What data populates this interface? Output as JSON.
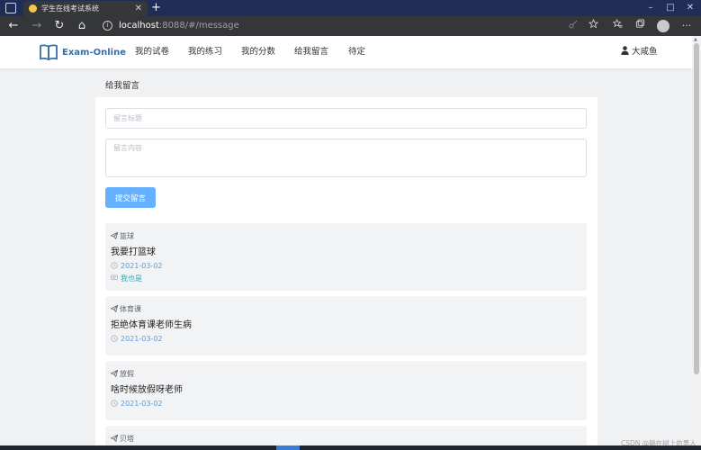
{
  "browser": {
    "tab_title": "学生在线考试系统",
    "url_host": "localhost",
    "url_rest": ":8088/#/message",
    "controls": {
      "back": "←",
      "forward": "→",
      "reload": "↻",
      "home": "⌂",
      "new_tab": "+",
      "minimize": "–",
      "maximize": "□",
      "close": "✕",
      "info": "i",
      "menu": "···"
    }
  },
  "header": {
    "logo_text": "Exam-Online",
    "nav": [
      "我的试卷",
      "我的练习",
      "我的分数",
      "给我留言",
      "待定"
    ],
    "user_name": "大咸鱼"
  },
  "message": {
    "section_title": "给我留言",
    "title_placeholder": "留言标题",
    "body_placeholder": "留言内容",
    "submit_label": "提交留言"
  },
  "cards": [
    {
      "tag": "篮球",
      "title": "我要打篮球",
      "date": "2021-03-02",
      "reply": "我也是"
    },
    {
      "tag": "体育课",
      "title": "拒绝体育课老师生病",
      "date": "2021-03-02"
    },
    {
      "tag": "放假",
      "title": "啥时候放假呀老师",
      "date": "2021-03-02"
    },
    {
      "tag": "贝塔"
    }
  ],
  "watermark": "CSDN @躺在树上的男人",
  "icons": {
    "logo": "book-icon",
    "user": "user-icon",
    "tag": "paper-plane-icon",
    "date": "clock-icon",
    "reply": "comment-icon"
  },
  "colors": {
    "primary_button": "#66b1ff",
    "date_text": "#5b9bd5",
    "reply_text": "#3ba6b4",
    "logo_text": "#3a6ea5",
    "card_bg": "#f2f3f5",
    "page_bg": "#f0f1f3"
  }
}
